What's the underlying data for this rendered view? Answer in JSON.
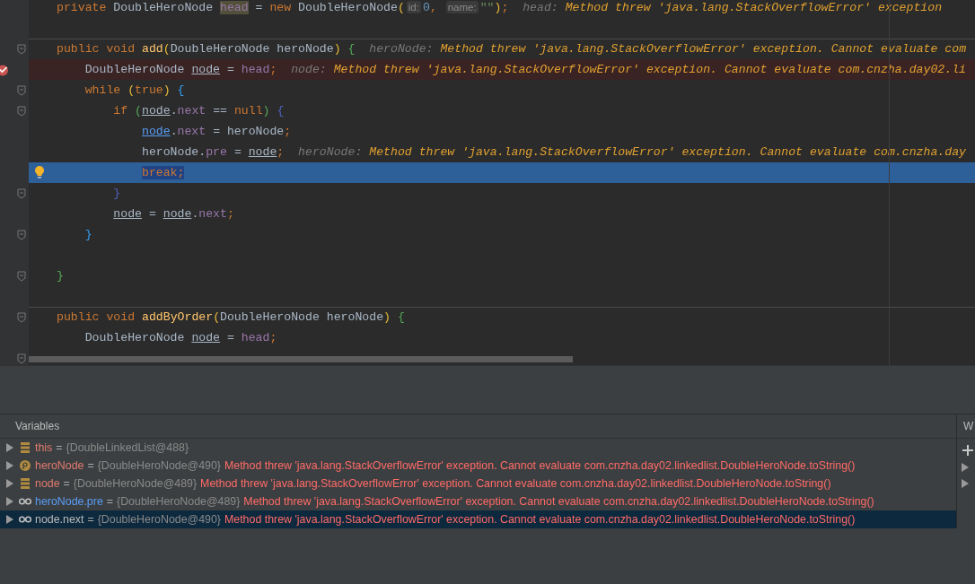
{
  "editor": {
    "lines": [
      {
        "kind": "normal",
        "fold": false,
        "separator": false,
        "tokens": [
          {
            "text": "private ",
            "kind": "kw"
          },
          {
            "text": "DoubleHeroNode ",
            "kind": "plain"
          },
          {
            "text": "head",
            "kind": "field-hl"
          },
          {
            "text": " = ",
            "kind": "plain"
          },
          {
            "text": "new ",
            "kind": "kw"
          },
          {
            "text": "DoubleHeroNode",
            "kind": "plain"
          },
          {
            "text": "(",
            "kind": "p1"
          },
          {
            "text": "id:",
            "kind": "hint"
          },
          {
            "text": "0",
            "kind": "num"
          },
          {
            "text": ", ",
            "kind": "kw"
          },
          {
            "text": "name:",
            "kind": "hint"
          },
          {
            "text": "\"\"",
            "kind": "str"
          },
          {
            "text": ")",
            "kind": "p1"
          },
          {
            "text": ";  ",
            "kind": "kw"
          },
          {
            "text": "head: ",
            "kind": "dbg-label"
          },
          {
            "text": "Method threw 'java.lang.StackOverflowError' exception",
            "kind": "dbg-value"
          }
        ]
      },
      {
        "kind": "normal",
        "fold": false,
        "separator": false
      },
      {
        "kind": "normal",
        "fold": true,
        "separator": true,
        "tokens": [
          {
            "text": "public ",
            "kind": "kw"
          },
          {
            "text": "void ",
            "kind": "kw"
          },
          {
            "text": "add",
            "kind": "method"
          },
          {
            "text": "(",
            "kind": "p1"
          },
          {
            "text": "DoubleHeroNode heroNode",
            "kind": "plain"
          },
          {
            "text": ")",
            "kind": "p1"
          },
          {
            "text": " {",
            "kind": "p2"
          },
          {
            "text": "  heroNode: ",
            "kind": "dbg-label"
          },
          {
            "text": "Method threw 'java.lang.StackOverflowError' exception. Cannot evaluate com",
            "kind": "dbg-value"
          }
        ]
      },
      {
        "kind": "breakpoint",
        "fold": false,
        "separator": false,
        "tokens": [
          {
            "text": "    DoubleHeroNode ",
            "kind": "plain"
          },
          {
            "text": "node",
            "kind": "local"
          },
          {
            "text": " = ",
            "kind": "plain"
          },
          {
            "text": "head",
            "kind": "field"
          },
          {
            "text": ";  ",
            "kind": "kw"
          },
          {
            "text": "node: ",
            "kind": "dbg-label"
          },
          {
            "text": "Method threw 'java.lang.StackOverflowError' exception. Cannot evaluate com.cnzha.day02.li",
            "kind": "dbg-value"
          }
        ]
      },
      {
        "kind": "normal",
        "fold": true,
        "separator": false,
        "tokens": [
          {
            "text": "    while ",
            "kind": "kw"
          },
          {
            "text": "(",
            "kind": "p1"
          },
          {
            "text": "true",
            "kind": "kw"
          },
          {
            "text": ")",
            "kind": "p1"
          },
          {
            "text": " {",
            "kind": "p3"
          }
        ]
      },
      {
        "kind": "normal",
        "fold": true,
        "separator": false,
        "tokens": [
          {
            "text": "        if ",
            "kind": "kw"
          },
          {
            "text": "(",
            "kind": "p2"
          },
          {
            "text": "node",
            "kind": "local"
          },
          {
            "text": ".",
            "kind": "plain"
          },
          {
            "text": "next",
            "kind": "field"
          },
          {
            "text": " == ",
            "kind": "plain"
          },
          {
            "text": "null",
            "kind": "kw"
          },
          {
            "text": ")",
            "kind": "p2"
          },
          {
            "text": " {",
            "kind": "p4"
          }
        ]
      },
      {
        "kind": "normal",
        "fold": false,
        "separator": false,
        "tokens": [
          {
            "text": "            node",
            "kind": "local-link"
          },
          {
            "text": ".",
            "kind": "plain"
          },
          {
            "text": "next",
            "kind": "field"
          },
          {
            "text": " = heroNode",
            "kind": "plain"
          },
          {
            "text": ";",
            "kind": "kw"
          }
        ]
      },
      {
        "kind": "normal",
        "fold": false,
        "separator": false,
        "tokens": [
          {
            "text": "            heroNode.",
            "kind": "plain"
          },
          {
            "text": "pre",
            "kind": "field"
          },
          {
            "text": " = ",
            "kind": "plain"
          },
          {
            "text": "node",
            "kind": "local"
          },
          {
            "text": ";  ",
            "kind": "kw"
          },
          {
            "text": "heroNode: ",
            "kind": "dbg-label"
          },
          {
            "text": "Method threw 'java.lang.StackOverflowError' exception. Cannot evaluate com.cnzha.day",
            "kind": "dbg-value"
          }
        ]
      },
      {
        "kind": "current",
        "fold": false,
        "separator": false,
        "tokens": [
          {
            "text": "            break;",
            "kind": "kw-sel"
          }
        ]
      },
      {
        "kind": "normal",
        "fold": true,
        "separator": false,
        "tokens": [
          {
            "text": "        }",
            "kind": "p4"
          }
        ]
      },
      {
        "kind": "normal",
        "fold": false,
        "separator": false,
        "tokens": [
          {
            "text": "        node",
            "kind": "local"
          },
          {
            "text": " = ",
            "kind": "plain"
          },
          {
            "text": "node",
            "kind": "local"
          },
          {
            "text": ".",
            "kind": "plain"
          },
          {
            "text": "next",
            "kind": "field"
          },
          {
            "text": ";",
            "kind": "kw"
          }
        ]
      },
      {
        "kind": "normal",
        "fold": true,
        "separator": false,
        "tokens": [
          {
            "text": "    }",
            "kind": "p3"
          }
        ]
      },
      {
        "kind": "normal",
        "fold": false,
        "separator": false
      },
      {
        "kind": "normal",
        "fold": true,
        "separator": false,
        "tokens": [
          {
            "text": "}",
            "kind": "p2"
          }
        ]
      },
      {
        "kind": "normal",
        "fold": false,
        "separator": false
      },
      {
        "kind": "normal",
        "fold": true,
        "separator": true,
        "tokens": [
          {
            "text": "public ",
            "kind": "kw"
          },
          {
            "text": "void ",
            "kind": "kw"
          },
          {
            "text": "addByOrder",
            "kind": "method"
          },
          {
            "text": "(",
            "kind": "p1"
          },
          {
            "text": "DoubleHeroNode heroNode",
            "kind": "plain"
          },
          {
            "text": ")",
            "kind": "p1"
          },
          {
            "text": " {",
            "kind": "p2"
          }
        ]
      },
      {
        "kind": "normal",
        "fold": false,
        "separator": false,
        "tokens": [
          {
            "text": "    DoubleHeroNode ",
            "kind": "plain"
          },
          {
            "text": "node",
            "kind": "local"
          },
          {
            "text": " = ",
            "kind": "plain"
          },
          {
            "text": "head",
            "kind": "field"
          },
          {
            "text": ";",
            "kind": "kw"
          }
        ]
      },
      {
        "kind": "normal",
        "fold": true,
        "separator": false
      }
    ]
  },
  "variables": {
    "title": "Variables",
    "rows": [
      {
        "kind": "field",
        "selected": false,
        "name": "this",
        "sign": "=",
        "value": "{DoubleLinkedList@488}"
      },
      {
        "kind": "param",
        "selected": false,
        "name": "heroNode",
        "sign": "=",
        "value": "{DoubleHeroNode@490}",
        "error": "Method threw 'java.lang.StackOverflowError' exception. Cannot evaluate com.cnzha.day02.linkedlist.DoubleHeroNode.toString()"
      },
      {
        "kind": "field",
        "selected": false,
        "name": "node",
        "sign": "=",
        "value": "{DoubleHeroNode@489}",
        "error": "Method threw 'java.lang.StackOverflowError' exception. Cannot evaluate com.cnzha.day02.linkedlist.DoubleHeroNode.toString()"
      },
      {
        "kind": "watch",
        "selected": false,
        "name": "heroNode.pre",
        "sign": "=",
        "value": "{DoubleHeroNode@489}",
        "error": "Method threw 'java.lang.StackOverflowError' exception. Cannot evaluate com.cnzha.day02.linkedlist.DoubleHeroNode.toString()"
      },
      {
        "kind": "watch",
        "selected": true,
        "name": "node.next",
        "sign": "=",
        "value": "{DoubleHeroNode@490}",
        "error": "Method threw 'java.lang.StackOverflowError' exception. Cannot evaluate com.cnzha.day02.linkedlist.DoubleHeroNode.toString()"
      }
    ]
  },
  "watches": {
    "title": "W"
  }
}
